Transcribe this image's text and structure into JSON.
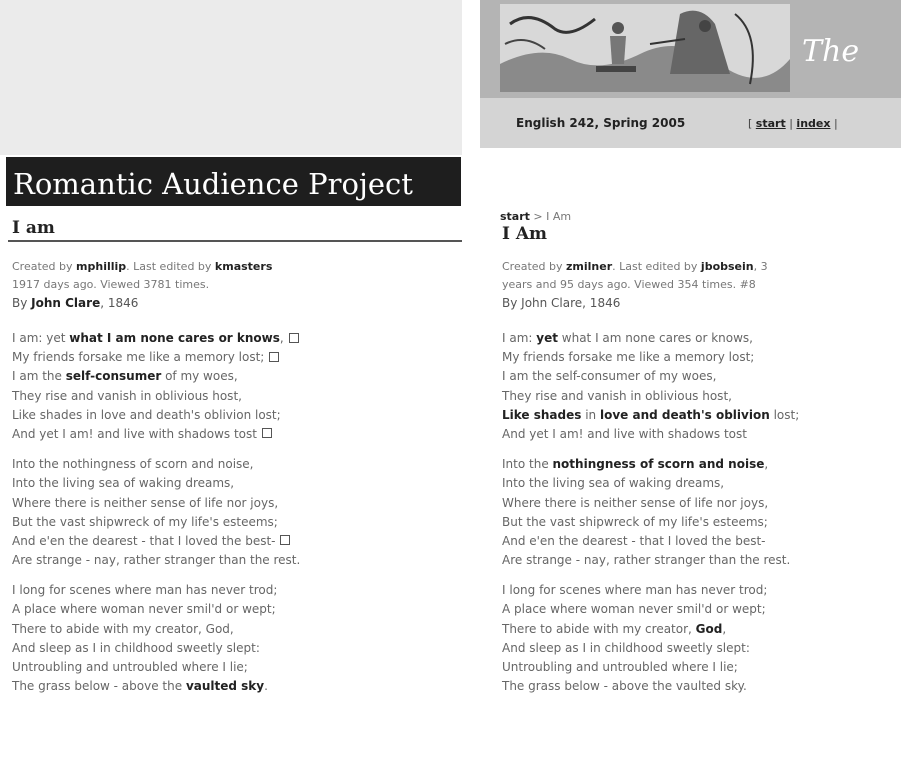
{
  "left": {
    "project_title": "Romantic Audience Project",
    "page_title": "I am",
    "meta": {
      "created_prefix": "Created by ",
      "created_by": "mphillip",
      "edited_prefix": ". Last edited by ",
      "edited_by": "kmasters",
      "age_views": "1917 days ago. Viewed 3781 times."
    },
    "byline": {
      "by": "By ",
      "author": "John Clare",
      "year": ", 1846"
    },
    "stanzas": [
      [
        [
          {
            "t": "I am: yet "
          },
          {
            "t": "what I am none cares or knows",
            "b": true
          },
          {
            "t": ","
          },
          {
            "icon": "note-icon"
          }
        ],
        [
          {
            "t": "My friends forsake me like a memory lost;"
          },
          {
            "icon": "note-icon"
          }
        ],
        [
          {
            "t": "I am the "
          },
          {
            "t": "self-consumer",
            "b": true
          },
          {
            "t": " of my woes,"
          }
        ],
        [
          {
            "t": "They rise and vanish in oblivious host,"
          }
        ],
        [
          {
            "t": "Like shades in love and death's oblivion lost;"
          }
        ],
        [
          {
            "t": "And yet I am! and live with shadows tost"
          },
          {
            "icon": "note-icon"
          }
        ]
      ],
      [
        [
          {
            "t": "Into the nothingness of scorn and noise,"
          }
        ],
        [
          {
            "t": "Into the living sea of waking dreams,"
          }
        ],
        [
          {
            "t": "Where there is neither sense of life nor joys,"
          }
        ],
        [
          {
            "t": "But the vast shipwreck of my life's esteems;"
          }
        ],
        [
          {
            "t": "And e'en the dearest - that I loved the best-"
          },
          {
            "icon": "note-icon"
          }
        ],
        [
          {
            "t": "Are strange - nay, rather stranger than the rest."
          }
        ]
      ],
      [
        [
          {
            "t": "I long for scenes where man has never trod;"
          }
        ],
        [
          {
            "t": "A place where woman never smil'd or wept;"
          }
        ],
        [
          {
            "t": "There to abide with my creator, God,"
          }
        ],
        [
          {
            "t": "And sleep as I in childhood sweetly slept:"
          }
        ],
        [
          {
            "t": "Untroubling and untroubled where I lie;"
          }
        ],
        [
          {
            "t": "The grass below - above the "
          },
          {
            "t": "vaulted sky",
            "b": true
          },
          {
            "t": "."
          }
        ]
      ]
    ]
  },
  "right": {
    "banner_title": "The",
    "course_title": "English 242, Spring 2005",
    "nav": {
      "open": "[ ",
      "start": "start",
      "sep1": " | ",
      "index": "index",
      "sep2": " |"
    },
    "breadcrumb": {
      "start": "start",
      "sep": " > ",
      "current": "I Am"
    },
    "page_title": "I Am",
    "meta": {
      "created_prefix": "Created by ",
      "created_by": "zmilner",
      "edited_prefix": ". Last edited by ",
      "edited_by": "jbobsein",
      "line1_tail": ", 3",
      "line2": "years and 95 days ago. Viewed 354 times. #8"
    },
    "byline": "By John Clare, 1846",
    "stanzas": [
      [
        [
          {
            "t": "I am: "
          },
          {
            "t": "yet",
            "b": true
          },
          {
            "t": " what I am none cares or knows,"
          }
        ],
        [
          {
            "t": "My friends forsake me like a memory lost;"
          }
        ],
        [
          {
            "t": "I am the self-consumer of my woes,"
          }
        ],
        [
          {
            "t": "They rise and vanish in oblivious host,"
          }
        ],
        [
          {
            "t": "Like shades",
            "b": true
          },
          {
            "t": " in "
          },
          {
            "t": "love and death's oblivion",
            "b": true
          },
          {
            "t": " lost;"
          }
        ],
        [
          {
            "t": "And yet I am! and live with shadows tost"
          }
        ]
      ],
      [
        [
          {
            "t": "Into the "
          },
          {
            "t": "nothingness of scorn and noise",
            "b": true
          },
          {
            "t": ","
          }
        ],
        [
          {
            "t": "Into the living sea of waking dreams,"
          }
        ],
        [
          {
            "t": "Where there is neither sense of life nor joys,"
          }
        ],
        [
          {
            "t": "But the vast shipwreck of my life's esteems;"
          }
        ],
        [
          {
            "t": "And e'en the dearest - that I loved the best-"
          }
        ],
        [
          {
            "t": "Are strange - nay, rather stranger than the rest."
          }
        ]
      ],
      [
        [
          {
            "t": "I long for scenes where man has never trod;"
          }
        ],
        [
          {
            "t": "A place where woman never smil'd or wept;"
          }
        ],
        [
          {
            "t": "There to abide with my creator, "
          },
          {
            "t": "God",
            "b": true
          },
          {
            "t": ","
          }
        ],
        [
          {
            "t": "And sleep as I in childhood sweetly slept:"
          }
        ],
        [
          {
            "t": "Untroubling and untroubled where I lie;"
          }
        ],
        [
          {
            "t": "The grass below - above the vaulted sky."
          }
        ]
      ]
    ]
  }
}
